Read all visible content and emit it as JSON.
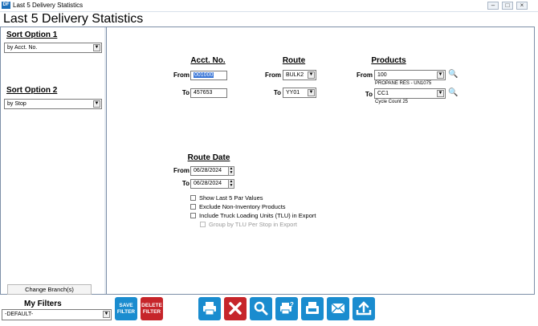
{
  "window": {
    "title": "Last 5 Delivery Statistics",
    "icon_text": "DF"
  },
  "heading": "Last 5 Delivery Statistics",
  "left_panel": {
    "sort1": {
      "label": "Sort Option 1",
      "value": "by Acct. No."
    },
    "sort2": {
      "label": "Sort Option 2",
      "value": "by Stop"
    },
    "change_branch": "Change Branch(s)"
  },
  "acct": {
    "heading": "Acct. No.",
    "from_label": "From",
    "from_value": "001000",
    "to_label": "To",
    "to_value": "457653"
  },
  "route": {
    "heading": "Route",
    "from_label": "From",
    "from_value": "BULK2",
    "to_label": "To",
    "to_value": "YY01"
  },
  "products": {
    "heading": "Products",
    "from_label": "From",
    "from_value": "100",
    "from_desc": "PROPANE RES - UN1075",
    "to_label": "To",
    "to_value": "CC1",
    "to_desc": "Cycle Count 25"
  },
  "route_date": {
    "heading": "Route Date",
    "from_label": "From",
    "from_value": "06/28/2024",
    "to_label": "To",
    "to_value": "06/28/2024"
  },
  "options": [
    {
      "label": "Show Last 5 Par Values",
      "checked": false,
      "enabled": true
    },
    {
      "label": "Exclude Non-Inventory Products",
      "checked": false,
      "enabled": true
    },
    {
      "label": "Include Truck Loading Units (TLU) in Export",
      "checked": false,
      "enabled": true
    },
    {
      "label": "Group by TLU Per Stop in Export",
      "checked": false,
      "enabled": false
    }
  ],
  "filters": {
    "label": "My Filters",
    "value": "-DEFAULT-"
  },
  "toolbar": {
    "save_filter": "SAVE FILTER",
    "delete_filter": "DELETE FILTER"
  },
  "colors": {
    "accent_blue": "#1a8ccf",
    "danger_red": "#c6252a",
    "selection_blue": "#3875d7"
  }
}
